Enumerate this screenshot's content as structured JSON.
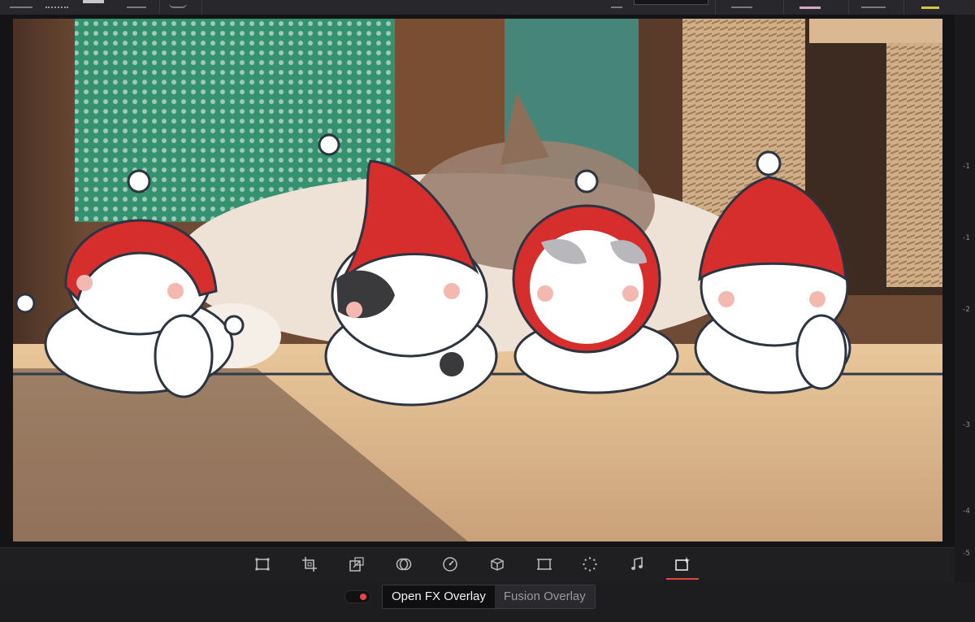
{
  "ruler": {
    "labels": [
      "-1",
      "-1",
      "-2",
      "-3",
      "-4",
      "-5"
    ]
  },
  "toolbar": {
    "tools": [
      {
        "name": "transform-tool-button",
        "icon": "transform-icon",
        "active": false
      },
      {
        "name": "crop-tool-button",
        "icon": "crop-icon",
        "active": false
      },
      {
        "name": "dynamic-zoom-button",
        "icon": "dynamic-zoom-icon",
        "active": false
      },
      {
        "name": "composite-button",
        "icon": "composite-icon",
        "active": false
      },
      {
        "name": "speed-button",
        "icon": "speed-gauge-icon",
        "active": false
      },
      {
        "name": "stabilization-button",
        "icon": "cube-icon",
        "active": false
      },
      {
        "name": "lens-correction-button",
        "icon": "frame-icon",
        "active": false
      },
      {
        "name": "effects-button",
        "icon": "dots-circle-icon",
        "active": false
      },
      {
        "name": "audio-button",
        "icon": "music-note-icon",
        "active": false
      },
      {
        "name": "fx-overlay-button",
        "icon": "fx-sparkle-icon",
        "active": true
      }
    ],
    "accent_color": "#e0453a"
  },
  "overlay": {
    "toggle_on": true,
    "open_fx_label": "Open FX Overlay",
    "fusion_label": "Fusion Overlay",
    "selected": "Open FX Overlay"
  }
}
